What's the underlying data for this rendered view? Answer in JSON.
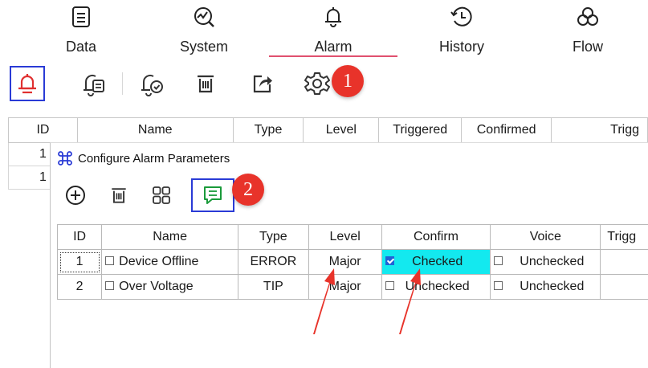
{
  "nav": {
    "items": [
      {
        "label": "Data",
        "icon": "document-list-icon"
      },
      {
        "label": "System",
        "icon": "system-monitor-icon"
      },
      {
        "label": "Alarm",
        "icon": "bell-icon"
      },
      {
        "label": "History",
        "icon": "history-clock-icon"
      },
      {
        "label": "Flow",
        "icon": "flow-knot-icon"
      }
    ],
    "active": "Alarm",
    "accent_color": "#e0506f"
  },
  "toolbar": {
    "buttons": [
      "bell-alarm-icon",
      "alarm-list-icon",
      "alarm-confirm-icon",
      "delete-icon",
      "export-icon",
      "settings-gear-icon"
    ],
    "selected": "bell-alarm-icon",
    "badge": "1"
  },
  "alarm_table": {
    "columns": [
      "ID",
      "Name",
      "Type",
      "Level",
      "Triggered",
      "Confirmed",
      "Trigg"
    ],
    "rows": [
      {
        "id": "1"
      },
      {
        "id": "1"
      }
    ]
  },
  "dialog": {
    "title": "Configure Alarm Parameters",
    "title_icon": "command-key-icon",
    "toolbar": {
      "buttons": [
        "add-circle-icon",
        "delete-icon",
        "grid-view-icon",
        "message-icon"
      ],
      "selected": "message-icon",
      "badge": "2"
    },
    "table": {
      "columns": [
        "ID",
        "Name",
        "Type",
        "Level",
        "Confirm",
        "Voice",
        "Trigg"
      ],
      "rows": [
        {
          "id": "1",
          "name": "Device Offline",
          "type": "ERROR",
          "level": "Major",
          "confirm": "Checked",
          "confirm_checked": true,
          "voice": "Unchecked",
          "voice_checked": false
        },
        {
          "id": "2",
          "name": "Over Voltage",
          "type": "TIP",
          "level": "Major",
          "confirm": "Unchecked",
          "confirm_checked": false,
          "voice": "Unchecked",
          "voice_checked": false
        }
      ]
    },
    "highlight_color": "#13e9ef"
  },
  "annotations": {
    "badge_color": "#e8332a",
    "arrow_color": "#e8332a"
  }
}
